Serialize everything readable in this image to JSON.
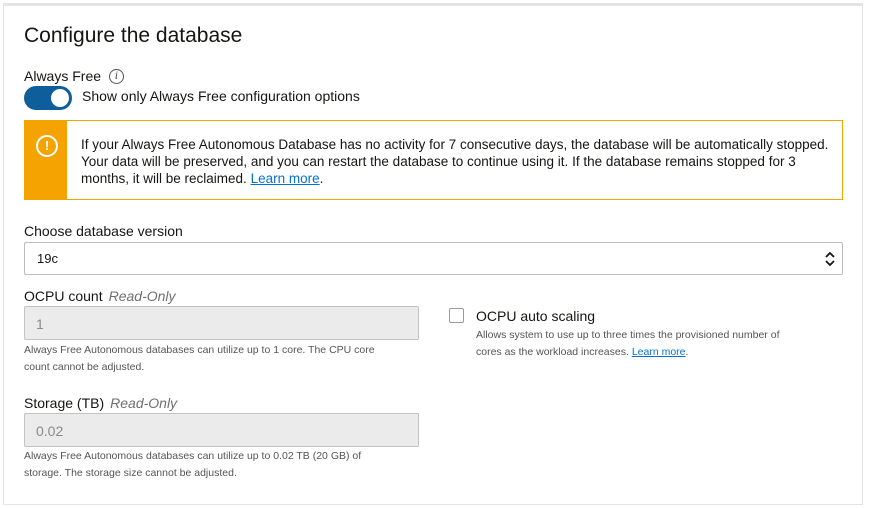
{
  "section": {
    "title": "Configure the database"
  },
  "always_free": {
    "label": "Always Free",
    "info_icon": "info-icon",
    "toggle_on": true,
    "toggle_label": "Show only Always Free configuration options"
  },
  "alert": {
    "icon": "warning-icon",
    "text": "If your Always Free Autonomous Database has no activity for 7 consecutive days, the database will be automatically stopped. Your data will be preserved, and you can restart the database to continue using it. If the database remains stopped for 3 months, it will be reclaimed.",
    "link_text": "Learn more",
    "suffix": ".",
    "accent_color": "#f4a300"
  },
  "db_version": {
    "label": "Choose database version",
    "value": "19c",
    "icon": "chevron-updown-icon"
  },
  "ocpu": {
    "label": "OCPU count",
    "read_only_label": "Read-Only",
    "value": "1",
    "help_line1": "Always Free Autonomous databases can utilize up to 1 core. The CPU core",
    "help_line2": "count cannot be adjusted."
  },
  "auto_scaling": {
    "label": "OCPU auto scaling",
    "checked": false,
    "help_line1": "Allows system to use up to three times the provisioned number of",
    "help_line2_prefix": "cores as the workload increases. ",
    "link_text": "Learn more",
    "suffix": "."
  },
  "storage": {
    "label": "Storage (TB)",
    "read_only_label": "Read-Only",
    "value": "0.02",
    "help_line1": "Always Free Autonomous databases can utilize up to 0.02 TB (20 GB) of",
    "help_line2": "storage. The storage size cannot be adjusted."
  }
}
